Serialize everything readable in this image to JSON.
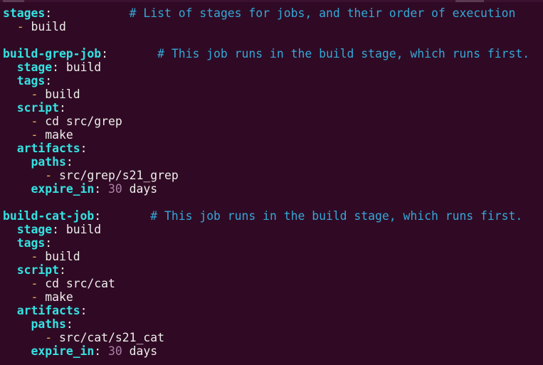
{
  "colors": {
    "background": "#300a24",
    "key": "#34e2e2",
    "comment": "#34a8d8",
    "dash": "#e6b450",
    "number": "#ad7fa8",
    "text": "#eeeeec"
  },
  "lines": [
    [
      {
        "t": "key",
        "v": "stages"
      },
      {
        "t": "colon",
        "v": ":"
      },
      {
        "t": "val",
        "v": "           "
      },
      {
        "t": "comment",
        "v": "# List of stages for jobs, and their order of execution"
      }
    ],
    [
      {
        "t": "val",
        "v": "  "
      },
      {
        "t": "dash",
        "v": "-"
      },
      {
        "t": "val",
        "v": " build"
      }
    ],
    [],
    [
      {
        "t": "key",
        "v": "build-grep-job"
      },
      {
        "t": "colon",
        "v": ":"
      },
      {
        "t": "val",
        "v": "       "
      },
      {
        "t": "comment",
        "v": "# This job runs in the build stage, which runs first."
      }
    ],
    [
      {
        "t": "val",
        "v": "  "
      },
      {
        "t": "key",
        "v": "stage"
      },
      {
        "t": "colon",
        "v": ":"
      },
      {
        "t": "val",
        "v": " build"
      }
    ],
    [
      {
        "t": "val",
        "v": "  "
      },
      {
        "t": "key",
        "v": "tags"
      },
      {
        "t": "colon",
        "v": ":"
      }
    ],
    [
      {
        "t": "val",
        "v": "    "
      },
      {
        "t": "dash",
        "v": "-"
      },
      {
        "t": "val",
        "v": " build"
      }
    ],
    [
      {
        "t": "val",
        "v": "  "
      },
      {
        "t": "key",
        "v": "script"
      },
      {
        "t": "colon",
        "v": ":"
      }
    ],
    [
      {
        "t": "val",
        "v": "    "
      },
      {
        "t": "dash",
        "v": "-"
      },
      {
        "t": "val",
        "v": " cd src/grep"
      }
    ],
    [
      {
        "t": "val",
        "v": "    "
      },
      {
        "t": "dash",
        "v": "-"
      },
      {
        "t": "val",
        "v": " make"
      }
    ],
    [
      {
        "t": "val",
        "v": "  "
      },
      {
        "t": "key",
        "v": "artifacts"
      },
      {
        "t": "colon",
        "v": ":"
      }
    ],
    [
      {
        "t": "val",
        "v": "    "
      },
      {
        "t": "key",
        "v": "paths"
      },
      {
        "t": "colon",
        "v": ":"
      }
    ],
    [
      {
        "t": "val",
        "v": "      "
      },
      {
        "t": "dash",
        "v": "-"
      },
      {
        "t": "val",
        "v": " src/grep/s21_grep"
      }
    ],
    [
      {
        "t": "val",
        "v": "    "
      },
      {
        "t": "key",
        "v": "expire_in"
      },
      {
        "t": "colon",
        "v": ":"
      },
      {
        "t": "val",
        "v": " "
      },
      {
        "t": "num",
        "v": "30"
      },
      {
        "t": "val",
        "v": " days"
      }
    ],
    [],
    [
      {
        "t": "key",
        "v": "build-cat-job"
      },
      {
        "t": "colon",
        "v": ":"
      },
      {
        "t": "val",
        "v": "       "
      },
      {
        "t": "comment",
        "v": "# This job runs in the build stage, which runs first."
      }
    ],
    [
      {
        "t": "val",
        "v": "  "
      },
      {
        "t": "key",
        "v": "stage"
      },
      {
        "t": "colon",
        "v": ":"
      },
      {
        "t": "val",
        "v": " build"
      }
    ],
    [
      {
        "t": "val",
        "v": "  "
      },
      {
        "t": "key",
        "v": "tags"
      },
      {
        "t": "colon",
        "v": ":"
      }
    ],
    [
      {
        "t": "val",
        "v": "    "
      },
      {
        "t": "dash",
        "v": "-"
      },
      {
        "t": "val",
        "v": " build"
      }
    ],
    [
      {
        "t": "val",
        "v": "  "
      },
      {
        "t": "key",
        "v": "script"
      },
      {
        "t": "colon",
        "v": ":"
      }
    ],
    [
      {
        "t": "val",
        "v": "    "
      },
      {
        "t": "dash",
        "v": "-"
      },
      {
        "t": "val",
        "v": " cd src/cat"
      }
    ],
    [
      {
        "t": "val",
        "v": "    "
      },
      {
        "t": "dash",
        "v": "-"
      },
      {
        "t": "val",
        "v": " make"
      }
    ],
    [
      {
        "t": "val",
        "v": "  "
      },
      {
        "t": "key",
        "v": "artifacts"
      },
      {
        "t": "colon",
        "v": ":"
      }
    ],
    [
      {
        "t": "val",
        "v": "    "
      },
      {
        "t": "key",
        "v": "paths"
      },
      {
        "t": "colon",
        "v": ":"
      }
    ],
    [
      {
        "t": "val",
        "v": "      "
      },
      {
        "t": "dash",
        "v": "-"
      },
      {
        "t": "val",
        "v": " src/cat/s21_cat"
      }
    ],
    [
      {
        "t": "val",
        "v": "    "
      },
      {
        "t": "key",
        "v": "expire_in"
      },
      {
        "t": "colon",
        "v": ":"
      },
      {
        "t": "val",
        "v": " "
      },
      {
        "t": "num",
        "v": "30"
      },
      {
        "t": "val",
        "v": " days"
      }
    ]
  ]
}
